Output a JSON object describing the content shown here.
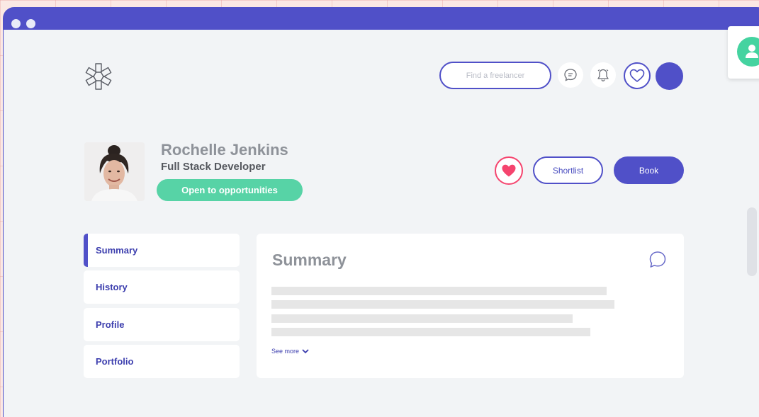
{
  "header": {
    "search_placeholder": "Find a freelancer",
    "icons": [
      "chat-bubble-icon",
      "bell-icon",
      "heart-icon",
      "user-avatar"
    ]
  },
  "profile": {
    "name": "Rochelle Jenkins",
    "role": "Full Stack Developer",
    "status": "Open to opportunities",
    "shortlist_label": "Shortlist",
    "book_label": "Book"
  },
  "nav": {
    "items": [
      {
        "label": "Summary",
        "active": true
      },
      {
        "label": "History",
        "active": false
      },
      {
        "label": "Profile",
        "active": false
      },
      {
        "label": "Portfolio",
        "active": false
      }
    ]
  },
  "summary": {
    "title": "Summary",
    "see_more": "See more"
  },
  "colors": {
    "primary": "#5050c8",
    "accent_green": "#57d3a6",
    "favorite_pink": "#f5446e",
    "background": "#f2f4f6"
  }
}
